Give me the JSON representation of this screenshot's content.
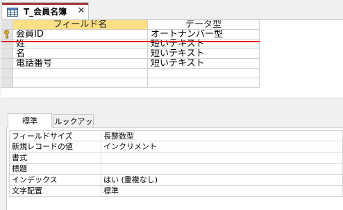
{
  "tab": {
    "title": "T_会員名簿",
    "close_glyph": "✕",
    "accent": "#a4373a"
  },
  "grid": {
    "headers": {
      "field_name": "フィールド名",
      "data_type": "データ型"
    },
    "rows": [
      {
        "name": "会員ID",
        "type": "オートナンバー型",
        "primary_key": true
      },
      {
        "name": "姓",
        "type": "短いテキスト"
      },
      {
        "name": "名",
        "type": "短いテキスト"
      },
      {
        "name": "電話番号",
        "type": "短いテキスト"
      },
      {
        "name": "",
        "type": ""
      },
      {
        "name": "",
        "type": ""
      }
    ],
    "active_header_color": "#fddf86",
    "selection_line_color": "#e21b1b"
  },
  "property_tabs": {
    "general": "標準",
    "lookup": "ルックアップ"
  },
  "properties": [
    {
      "name": "フィールドサイズ",
      "value": "長整数型"
    },
    {
      "name": "新規レコードの値",
      "value": "インクリメント"
    },
    {
      "name": "書式",
      "value": ""
    },
    {
      "name": "標題",
      "value": ""
    },
    {
      "name": "インデックス",
      "value": "はい (重複なし)"
    },
    {
      "name": "文字配置",
      "value": "標準"
    }
  ]
}
